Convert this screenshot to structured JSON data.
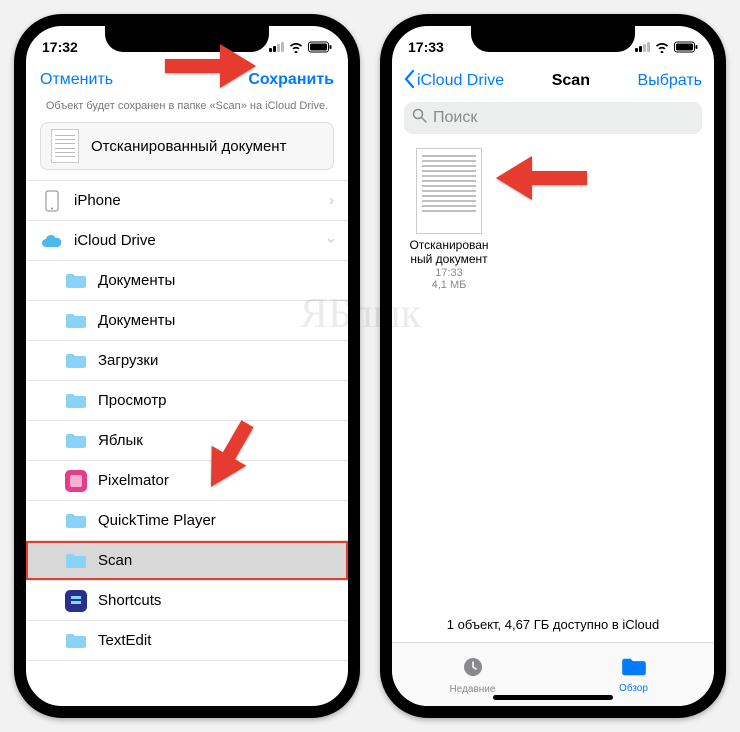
{
  "phone1": {
    "status_time": "17:32",
    "cancel": "Отменить",
    "save": "Сохранить",
    "subtitle": "Объект будет сохранен в папке «Scan» на iCloud Drive.",
    "doc_name": "Отсканированный документ",
    "loc_iphone": "iPhone",
    "loc_icloud": "iCloud Drive",
    "folders": {
      "f0": "Документы",
      "f1": "Документы",
      "f2": "Загрузки",
      "f3": "Просмотр",
      "f4": "Яблык",
      "f5": "Pixelmator",
      "f6": "QuickTime Player",
      "f7": "Scan",
      "f8": "Shortcuts",
      "f9": "TextEdit"
    }
  },
  "phone2": {
    "status_time": "17:33",
    "back_label": "iCloud Drive",
    "title": "Scan",
    "select": "Выбрать",
    "search_placeholder": "Поиск",
    "file_name1": "Отсканирован",
    "file_name2": "ный документ",
    "file_time": "17:33",
    "file_size": "4,1 МБ",
    "footer": "1 объект, 4,67 ГБ доступно в iCloud",
    "tab_recent": "Недавние",
    "tab_browse": "Обзор"
  },
  "watermark": "ЯБлык"
}
